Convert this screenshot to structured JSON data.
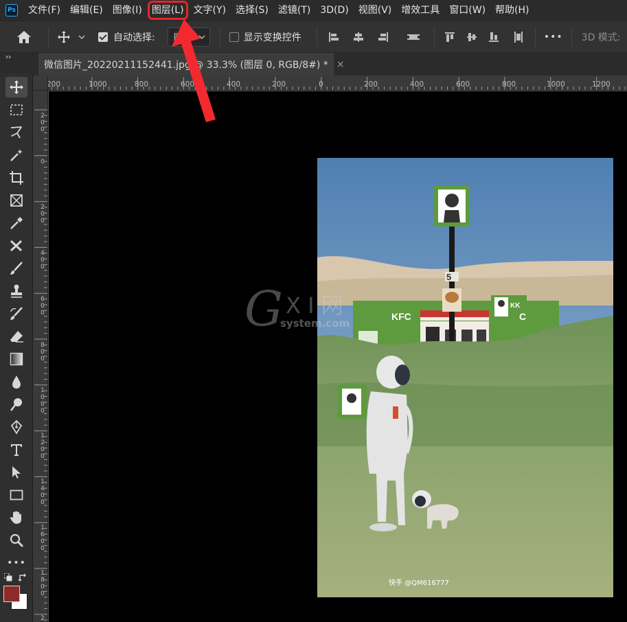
{
  "app": {
    "logo": "Ps"
  },
  "menu": {
    "items": [
      "文件(F)",
      "编辑(E)",
      "图像(I)",
      "图层(L)",
      "文字(Y)",
      "选择(S)",
      "滤镜(T)",
      "3D(D)",
      "视图(V)",
      "增效工具",
      "窗口(W)",
      "帮助(H)"
    ],
    "highlighted_index": 3
  },
  "options": {
    "auto_select_label": "自动选择:",
    "auto_select_checked": true,
    "auto_select_value": "图",
    "show_transform_label": "显示变换控件",
    "show_transform_checked": false,
    "more_label": "•••",
    "mode_3d_label": "3D 模式:"
  },
  "document": {
    "tab_title": "微信图片_20220211152441.jpg @ 33.3% (图层 0, RGB/8#) *",
    "close_label": "×"
  },
  "ruler": {
    "h_labels": [
      "200",
      "1000",
      "800",
      "600",
      "400",
      "200",
      "0",
      "200",
      "400",
      "600",
      "800",
      "1000",
      "1200"
    ],
    "v_labels": [
      "200",
      "0",
      "200",
      "400",
      "600",
      "800",
      "1000",
      "1200",
      "1400",
      "1600",
      "1800",
      "2"
    ]
  },
  "photo": {
    "sign_kfc": "KFC",
    "sign_kk": "KK",
    "sign_c": "C",
    "pole_number": "5",
    "watermark": "快手 @QM616777"
  },
  "overlay_watermark": {
    "g": "G",
    "xi": "X I 网",
    "site": "system.com"
  },
  "colors": {
    "highlight": "#e3262b",
    "foreground": "#8b2c2a",
    "background": "#ffffff"
  },
  "icons": [
    "home-icon",
    "move-icon",
    "chevron-down-icon",
    "align-left-icon",
    "align-center-icon",
    "align-right-icon",
    "distribute-icon",
    "align-top-icon",
    "align-middle-icon",
    "align-bottom-icon",
    "distribute-h-icon",
    "more-icon",
    "marquee-icon",
    "lasso-icon",
    "magic-wand-icon",
    "crop-icon",
    "frame-icon",
    "eyedropper-icon",
    "healing-icon",
    "brush-icon",
    "stamp-icon",
    "history-brush-icon",
    "eraser-icon",
    "gradient-icon",
    "blur-icon",
    "dodge-icon",
    "pen-icon",
    "type-icon",
    "path-select-icon",
    "rectangle-icon",
    "hand-icon",
    "zoom-icon",
    "swap-colors-icon"
  ]
}
